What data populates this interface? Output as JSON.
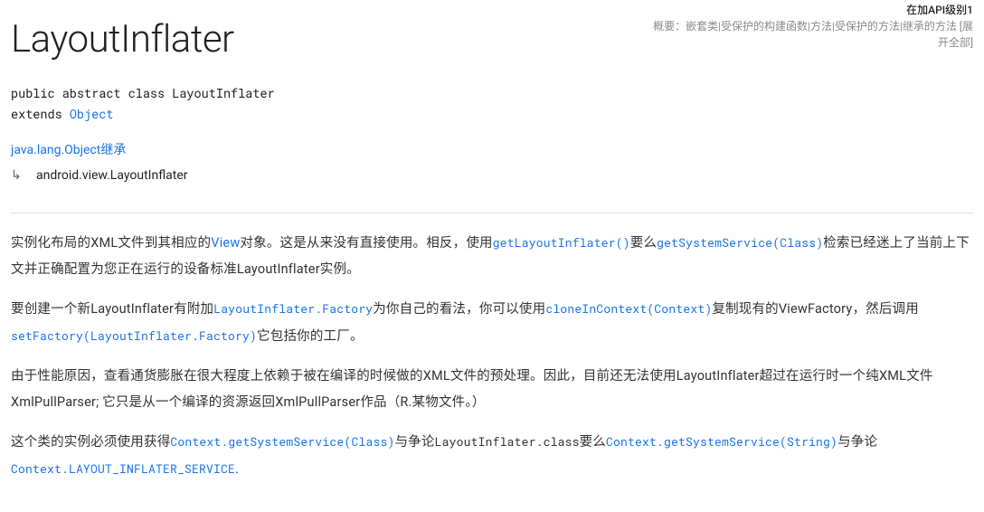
{
  "header": {
    "api_level": "在加API级别1",
    "summary_label": "概要：",
    "summary_items": "嵌套类|受保护的构建函数|方法|受保护的方法|继承的方法 [展开全部]",
    "title": "LayoutInflater",
    "sig_line1": "public abstract class LayoutInflater",
    "sig_extends": "extends ",
    "sig_parent": "Object"
  },
  "inherit": {
    "parent_link": "java.lang.Object继承",
    "child": "android.view.LayoutInflater"
  },
  "p1": {
    "t1": "实例化布局的XML文件到其相应的",
    "l1": "View",
    "t2": "对象。这是从来没有直接使用。相反，使用",
    "l2": "getLayoutInflater()",
    "t3": "要么",
    "l3": "getSystemService(Class)",
    "t4": "检索已经迷上了当前上下文并正确配置为您正在运行的设备标准LayoutInflater实例。"
  },
  "p2": {
    "t1": "要创建一个新LayoutInflater有附加",
    "l1": "LayoutInflater.Factory",
    "t2": "为你自己的看法，你可以使用",
    "l2": "cloneInContext(Context)",
    "t3": "复制现有的ViewFactory，然后调用",
    "l3": "setFactory(LayoutInflater.Factory)",
    "t4": "它包括你的工厂。"
  },
  "p3": {
    "t1": "由于性能原因，查看通货膨胀在很大程度上依赖于被在编译的时候做的XML文件的预处理。因此，目前还无法使用LayoutInflater超过在运行时一个纯XML文件XmlPullParser; 它只是从一个编译的资源返回XmlPullParser作品（R.某物文件。）"
  },
  "p4": {
    "t1": "这个类的实例必须使用获得",
    "l1": "Context.getSystemService(Class)",
    "t2": "与争论",
    "b1": "LayoutInflater.class",
    "t3": "要么",
    "l2": "Context.getSystemService(String)",
    "t4": "与争论",
    "l3": "Context.LAYOUT_INFLATER_SERVICE",
    "t5": "."
  }
}
